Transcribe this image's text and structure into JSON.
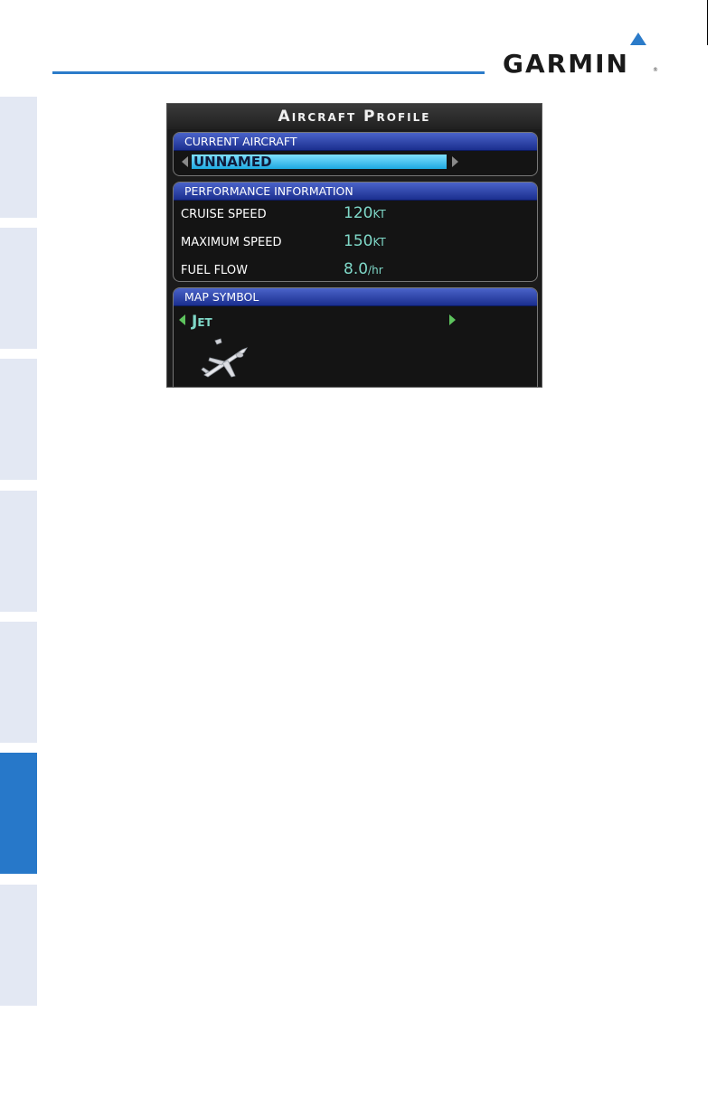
{
  "brand": {
    "name": "GARMIN",
    "registered": "®"
  },
  "screen": {
    "title": "Aircraft Profile",
    "current_aircraft": {
      "header": "CURRENT AIRCRAFT",
      "value": "UNNAMED"
    },
    "performance": {
      "header": "PERFORMANCE INFORMATION",
      "rows": [
        {
          "label": "CRUISE SPEED",
          "value": "120",
          "unit": "KT"
        },
        {
          "label": "MAXIMUM SPEED",
          "value": "150",
          "unit": "KT"
        },
        {
          "label": "FUEL FLOW",
          "value": "8.0",
          "unit": "/hr"
        }
      ]
    },
    "map_symbol": {
      "header": "MAP SYMBOL",
      "value": "Jet",
      "icon": "jet-aircraft-icon"
    }
  },
  "colors": {
    "accent": "#2778c9",
    "header_bar": "#1b2f8f",
    "value_text": "#7fd8c8",
    "selection": "#1ea8e0",
    "arrow_active": "#5ec45e"
  }
}
